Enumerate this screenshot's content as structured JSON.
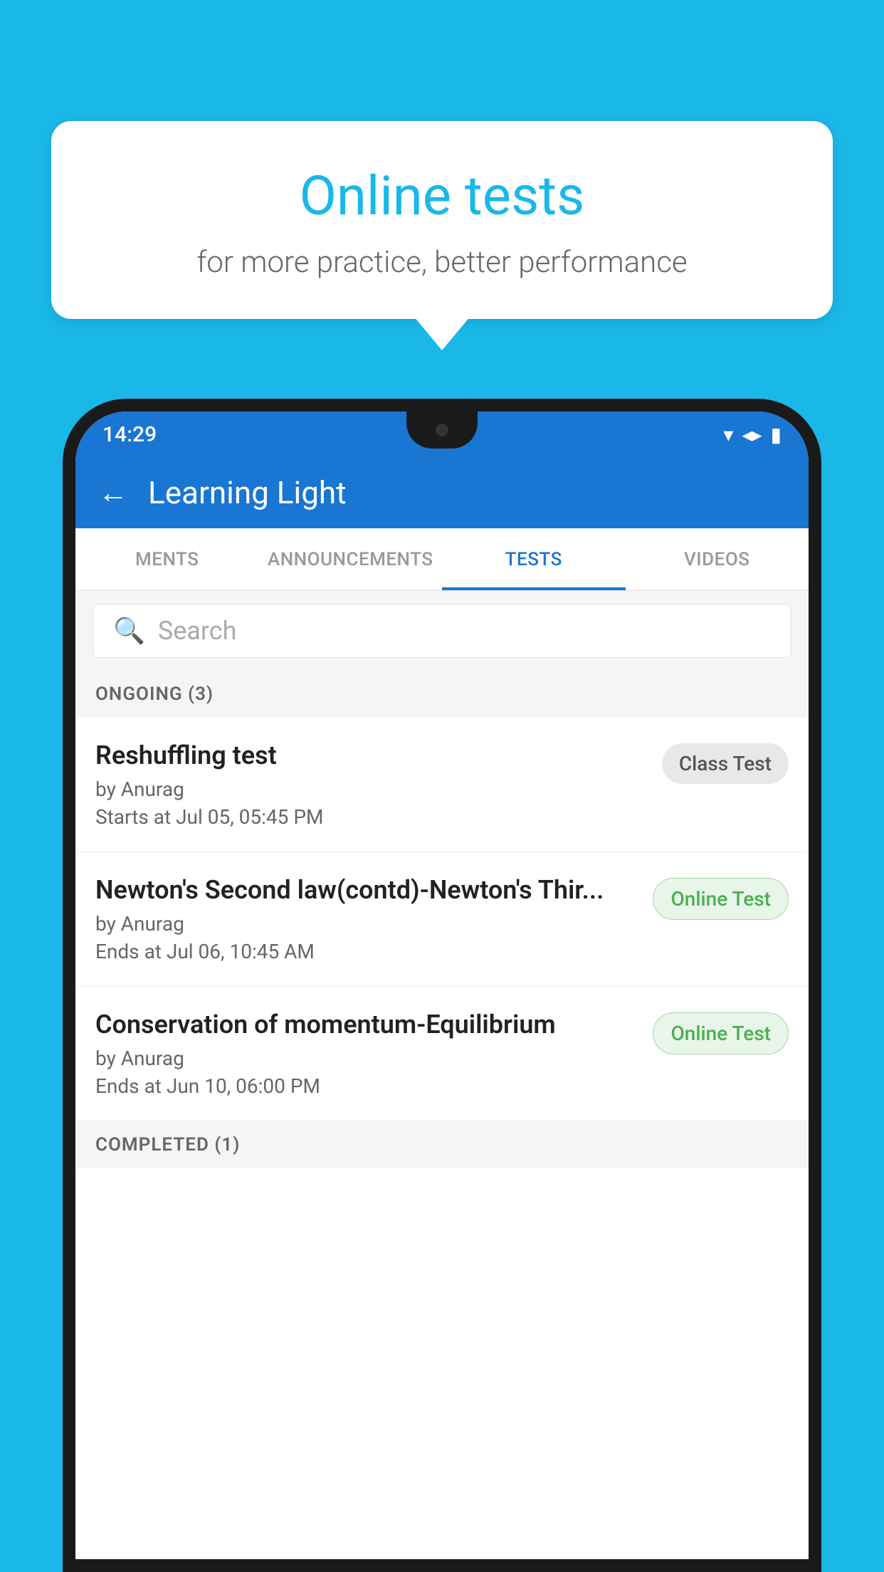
{
  "background_color": "#1ab8e8",
  "bubble": {
    "title": "Online tests",
    "subtitle": "for more practice, better performance"
  },
  "phone": {
    "status_bar": {
      "time": "14:29"
    },
    "app_bar": {
      "title": "Learning Light",
      "back_label": "←"
    },
    "tabs": [
      {
        "label": "MENTS",
        "active": false
      },
      {
        "label": "ANNOUNCEMENTS",
        "active": false
      },
      {
        "label": "TESTS",
        "active": true
      },
      {
        "label": "VIDEOS",
        "active": false
      }
    ],
    "search": {
      "placeholder": "Search"
    },
    "ongoing_section": {
      "label": "ONGOING (3)"
    },
    "tests": [
      {
        "name": "Reshuffling test",
        "author": "by Anurag",
        "time_label": "Starts at",
        "time": "Jul 05, 05:45 PM",
        "badge": "Class Test",
        "badge_type": "class"
      },
      {
        "name": "Newton's Second law(contd)-Newton's Thir...",
        "author": "by Anurag",
        "time_label": "Ends at",
        "time": "Jul 06, 10:45 AM",
        "badge": "Online Test",
        "badge_type": "online"
      },
      {
        "name": "Conservation of momentum-Equilibrium",
        "author": "by Anurag",
        "time_label": "Ends at",
        "time": "Jun 10, 06:00 PM",
        "badge": "Online Test",
        "badge_type": "online"
      }
    ],
    "completed_section": {
      "label": "COMPLETED (1)"
    }
  }
}
